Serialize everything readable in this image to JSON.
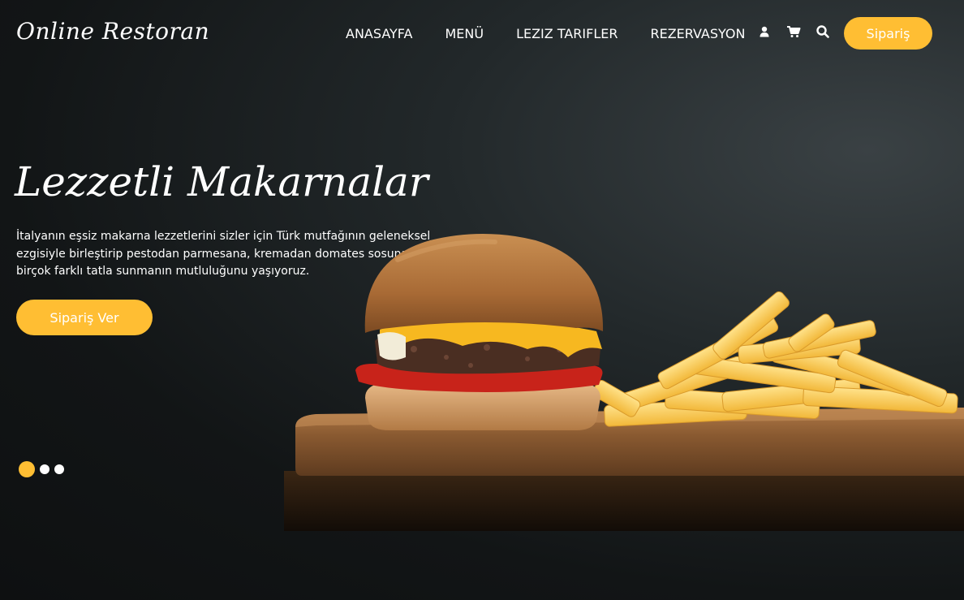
{
  "header": {
    "brand": "Online Restoran",
    "nav": [
      "ANASAYFA",
      "MENÜ",
      "LEZIZ TARIFLER",
      "REZERVASYON"
    ],
    "icons": [
      "user-icon",
      "cart-icon",
      "search-icon"
    ],
    "order_label": "Sipariş"
  },
  "hero": {
    "title": "Lezzetli Makarnalar",
    "description": "İtalyanın eşsiz makarna lezzetlerini sizler için Türk mutfağının geleneksel ezgisiyle birleştirip pestodan parmesana, kremadan domates sosuna kadar birçok farklı tatla sunmanın mutluluğunu yaşıyoruz.",
    "cta_label": "Sipariş Ver",
    "image": "burger-and-fries-photo"
  },
  "carousel": {
    "slides": 3,
    "active": 0
  },
  "colors": {
    "accent": "#ffbe33",
    "background": "#121516",
    "text": "#ffffff"
  }
}
